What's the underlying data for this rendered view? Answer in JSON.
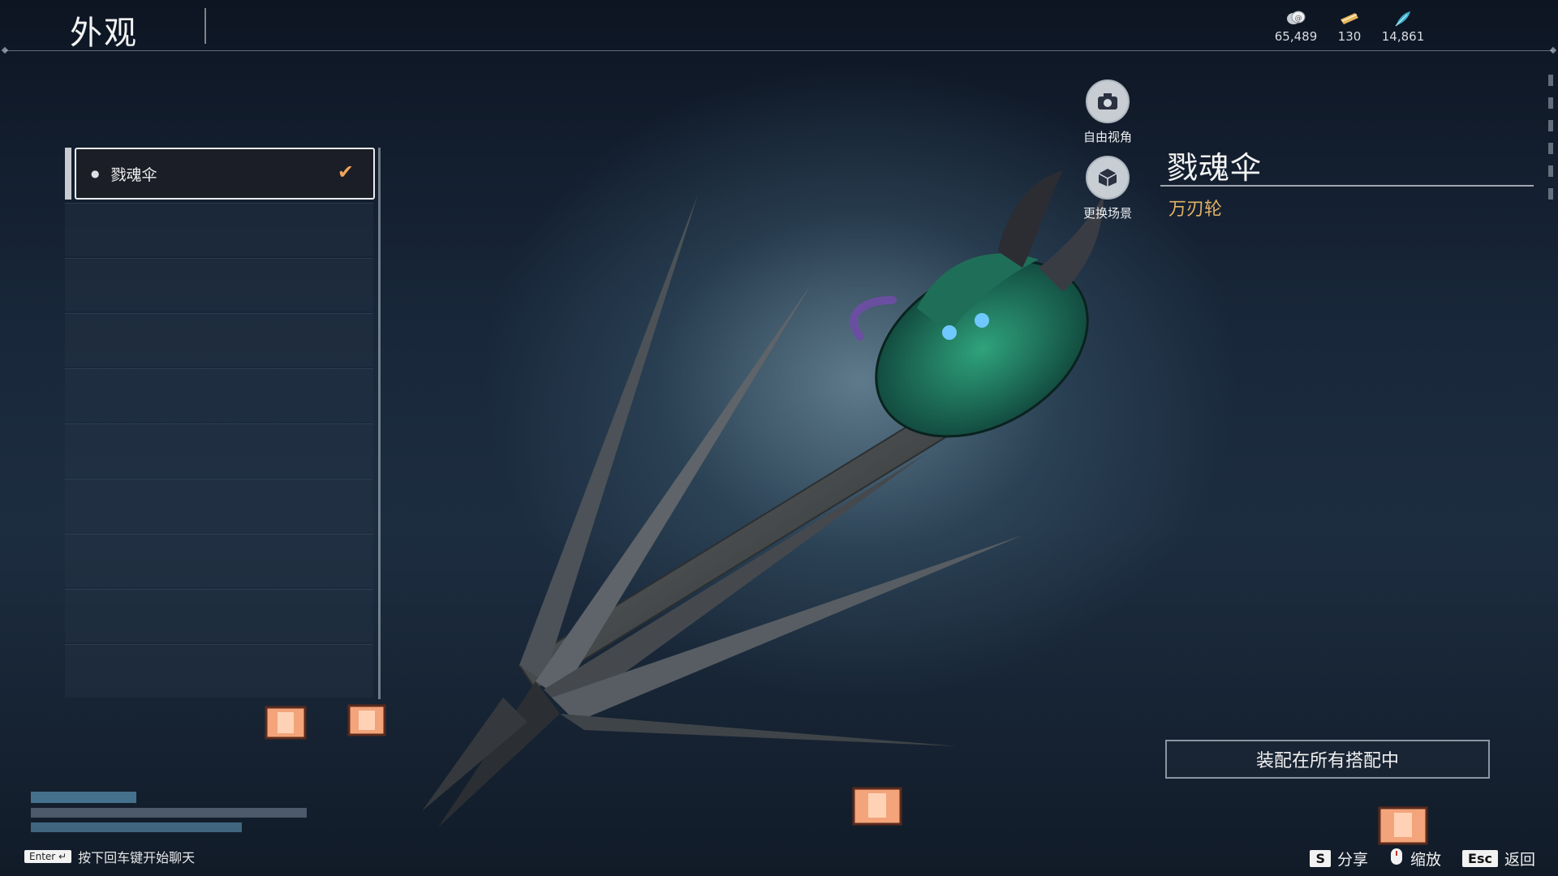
{
  "header": {
    "title": "外观"
  },
  "currencies": [
    {
      "icon": "coin-icon",
      "value": "65,489"
    },
    {
      "icon": "ticket-icon",
      "value": "130"
    },
    {
      "icon": "feather-icon",
      "value": "14,861"
    }
  ],
  "list": {
    "items": [
      {
        "label": "戮魂伞",
        "selected": true
      }
    ],
    "empty_slots": 9
  },
  "side_buttons": {
    "free_view": "自由视角",
    "change_scene": "更换场景"
  },
  "detail": {
    "name": "戮魂伞",
    "type": "万刃轮",
    "equip_button": "装配在所有搭配中"
  },
  "bottom": {
    "chat_key": "Enter ↵",
    "chat_hint": "按下回车键开始聊天",
    "actions": [
      {
        "key": "S",
        "label": "分享"
      },
      {
        "key": "",
        "label": "缩放"
      },
      {
        "key": "Esc",
        "label": "返回"
      }
    ]
  },
  "colors": {
    "accent": "#e2b264",
    "check": "#f0a35c"
  }
}
